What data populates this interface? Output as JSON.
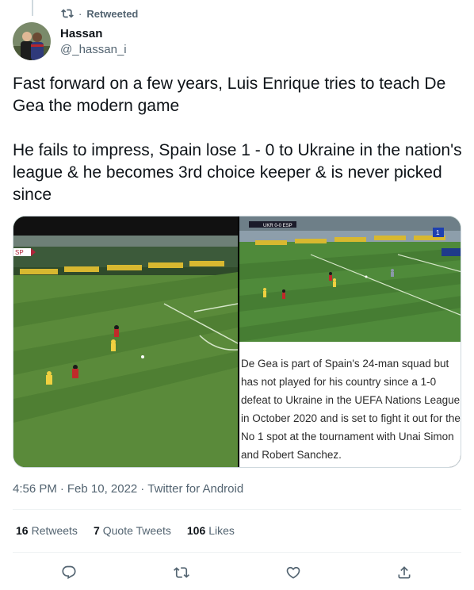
{
  "retweet": {
    "label": "Retweeted",
    "separator": "·"
  },
  "author": {
    "name": "Hassan",
    "handle": "@_hassan_i"
  },
  "tweet": {
    "paragraph_1": "Fast forward on a few years, Luis Enrique tries to teach De Gea the modern game",
    "paragraph_2": "He fails to impress, Spain lose 1 - 0 to Ukraine in the nation's league & he becomes 3rd choice keeper & is never picked since"
  },
  "media": {
    "left_overlay": "SP",
    "right_scorebug": "UKR 0-0 ESP",
    "right_badge": "1",
    "caption": "De Gea is part of Spain's 24-man squad but has not played for his country since a 1-0 defeat to Ukraine in the UEFA Nations League in October 2020 and is set to fight it out for the No 1 spot at the tournament with Unai Simon and Robert Sanchez."
  },
  "meta": {
    "time": "4:56 PM",
    "dot1": "·",
    "date": "Feb 10, 2022",
    "dot2": "·",
    "source": "Twitter for Android"
  },
  "stats": {
    "retweets_count": "16",
    "retweets_label": "Retweets",
    "quotes_count": "7",
    "quotes_label": "Quote Tweets",
    "likes_count": "106",
    "likes_label": "Likes"
  },
  "icons": {
    "retweet": "retweet-icon",
    "reply": "reply-icon",
    "like": "heart-icon",
    "share": "share-icon"
  },
  "colors": {
    "secondary_text": "#536471",
    "divider": "#eff3f4",
    "pitch": "#5a8a3a"
  }
}
